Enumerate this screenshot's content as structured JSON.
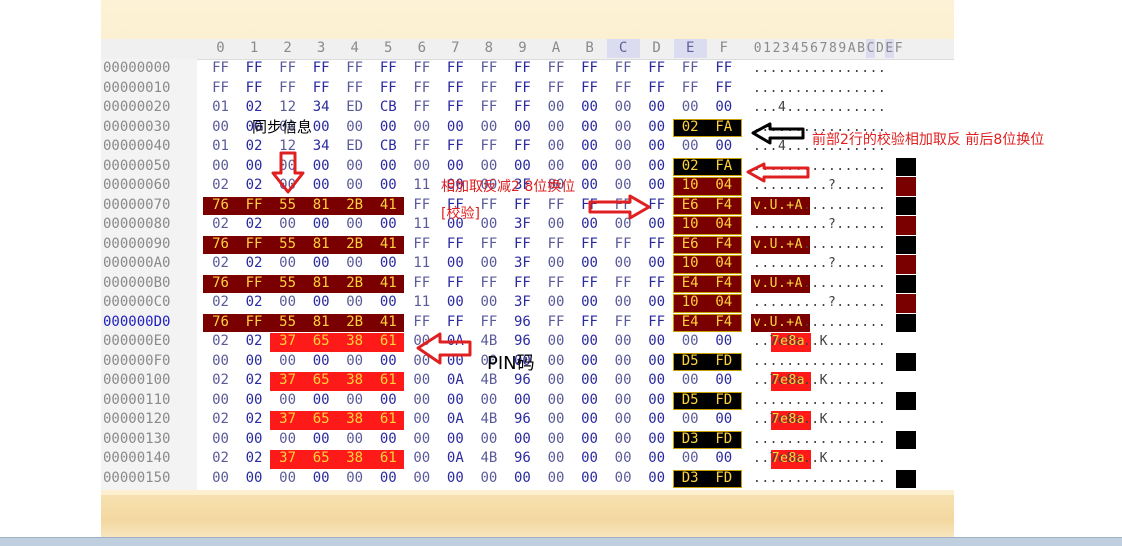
{
  "columns": [
    "0",
    "1",
    "2",
    "3",
    "4",
    "5",
    "6",
    "7",
    "8",
    "9",
    "A",
    "B",
    "C",
    "D",
    "E",
    "F"
  ],
  "ascii_header": "0123456789ABCDEF",
  "selected_columns": [
    "C",
    "E"
  ],
  "current_row_offset": "000000D0",
  "rows": [
    {
      "offset": "00000000",
      "bytes": [
        "FF",
        "FF",
        "FF",
        "FF",
        "FF",
        "FF",
        "FF",
        "FF",
        "FF",
        "FF",
        "FF",
        "FF",
        "FF",
        "FF",
        "FF",
        "FF"
      ],
      "ascii": "................"
    },
    {
      "offset": "00000010",
      "bytes": [
        "FF",
        "FF",
        "FF",
        "FF",
        "FF",
        "FF",
        "FF",
        "FF",
        "FF",
        "FF",
        "FF",
        "FF",
        "FF",
        "FF",
        "FF",
        "FF"
      ],
      "ascii": "................"
    },
    {
      "offset": "00000020",
      "bytes": [
        "01",
        "02",
        "12",
        "34",
        "ED",
        "CB",
        "FF",
        "FF",
        "FF",
        "FF",
        "00",
        "00",
        "00",
        "00",
        "00",
        "00"
      ],
      "ascii": "...4............"
    },
    {
      "offset": "00000030",
      "bytes": [
        "00",
        "00",
        "00",
        "00",
        "00",
        "00",
        "00",
        "00",
        "00",
        "00",
        "00",
        "00",
        "00",
        "00",
        "02",
        "FA"
      ],
      "ascii": "................"
    },
    {
      "offset": "00000040",
      "bytes": [
        "01",
        "02",
        "12",
        "34",
        "ED",
        "CB",
        "FF",
        "FF",
        "FF",
        "FF",
        "00",
        "00",
        "00",
        "00",
        "00",
        "00"
      ],
      "ascii": "...4............"
    },
    {
      "offset": "00000050",
      "bytes": [
        "00",
        "00",
        "00",
        "00",
        "00",
        "00",
        "00",
        "00",
        "00",
        "00",
        "00",
        "00",
        "00",
        "00",
        "02",
        "FA"
      ],
      "ascii": "................"
    },
    {
      "offset": "00000060",
      "bytes": [
        "02",
        "02",
        "00",
        "00",
        "00",
        "00",
        "11",
        "00",
        "00",
        "3F",
        "00",
        "00",
        "00",
        "00",
        "10",
        "04"
      ],
      "ascii": ".........?......"
    },
    {
      "offset": "00000070",
      "bytes": [
        "76",
        "FF",
        "55",
        "81",
        "2B",
        "41",
        "FF",
        "FF",
        "FF",
        "FF",
        "FF",
        "FF",
        "FF",
        "FF",
        "E6",
        "F4"
      ],
      "ascii": "v.U.+A.........."
    },
    {
      "offset": "00000080",
      "bytes": [
        "02",
        "02",
        "00",
        "00",
        "00",
        "00",
        "11",
        "00",
        "00",
        "3F",
        "00",
        "00",
        "00",
        "00",
        "10",
        "04"
      ],
      "ascii": ".........?......"
    },
    {
      "offset": "00000090",
      "bytes": [
        "76",
        "FF",
        "55",
        "81",
        "2B",
        "41",
        "FF",
        "FF",
        "FF",
        "FF",
        "FF",
        "FF",
        "FF",
        "FF",
        "E6",
        "F4"
      ],
      "ascii": "v.U.+A.........."
    },
    {
      "offset": "000000A0",
      "bytes": [
        "02",
        "02",
        "00",
        "00",
        "00",
        "00",
        "11",
        "00",
        "00",
        "3F",
        "00",
        "00",
        "00",
        "00",
        "10",
        "04"
      ],
      "ascii": ".........?......"
    },
    {
      "offset": "000000B0",
      "bytes": [
        "76",
        "FF",
        "55",
        "81",
        "2B",
        "41",
        "FF",
        "FF",
        "FF",
        "FF",
        "FF",
        "FF",
        "FF",
        "FF",
        "E4",
        "F4"
      ],
      "ascii": "v.U.+A.........."
    },
    {
      "offset": "000000C0",
      "bytes": [
        "02",
        "02",
        "00",
        "00",
        "00",
        "00",
        "11",
        "00",
        "00",
        "3F",
        "00",
        "00",
        "00",
        "00",
        "10",
        "04"
      ],
      "ascii": ".........?......"
    },
    {
      "offset": "000000D0",
      "bytes": [
        "76",
        "FF",
        "55",
        "81",
        "2B",
        "41",
        "FF",
        "FF",
        "FF",
        "96",
        "FF",
        "FF",
        "FF",
        "FF",
        "E4",
        "F4"
      ],
      "ascii": "v.U.+A.........."
    },
    {
      "offset": "000000E0",
      "bytes": [
        "02",
        "02",
        "37",
        "65",
        "38",
        "61",
        "00",
        "0A",
        "4B",
        "96",
        "00",
        "00",
        "00",
        "00",
        "00",
        "00"
      ],
      "ascii": "..7e8a..K......."
    },
    {
      "offset": "000000F0",
      "bytes": [
        "00",
        "00",
        "00",
        "00",
        "00",
        "00",
        "00",
        "00",
        "00",
        "00",
        "00",
        "00",
        "00",
        "00",
        "D5",
        "FD"
      ],
      "ascii": "................"
    },
    {
      "offset": "00000100",
      "bytes": [
        "02",
        "02",
        "37",
        "65",
        "38",
        "61",
        "00",
        "0A",
        "4B",
        "96",
        "00",
        "00",
        "00",
        "00",
        "00",
        "00"
      ],
      "ascii": "..7e8a..K......."
    },
    {
      "offset": "00000110",
      "bytes": [
        "00",
        "00",
        "00",
        "00",
        "00",
        "00",
        "00",
        "00",
        "00",
        "00",
        "00",
        "00",
        "00",
        "00",
        "D5",
        "FD"
      ],
      "ascii": "................"
    },
    {
      "offset": "00000120",
      "bytes": [
        "02",
        "02",
        "37",
        "65",
        "38",
        "61",
        "00",
        "0A",
        "4B",
        "96",
        "00",
        "00",
        "00",
        "00",
        "00",
        "00"
      ],
      "ascii": "..7e8a..K......."
    },
    {
      "offset": "00000130",
      "bytes": [
        "00",
        "00",
        "00",
        "00",
        "00",
        "00",
        "00",
        "00",
        "00",
        "00",
        "00",
        "00",
        "00",
        "00",
        "D3",
        "FD"
      ],
      "ascii": "................"
    },
    {
      "offset": "00000140",
      "bytes": [
        "02",
        "02",
        "37",
        "65",
        "38",
        "61",
        "00",
        "0A",
        "4B",
        "96",
        "00",
        "00",
        "00",
        "00",
        "00",
        "00"
      ],
      "ascii": "..7e8a..K......."
    },
    {
      "offset": "00000150",
      "bytes": [
        "00",
        "00",
        "00",
        "00",
        "00",
        "00",
        "00",
        "00",
        "00",
        "00",
        "00",
        "00",
        "00",
        "00",
        "D3",
        "FD"
      ],
      "ascii": "................"
    }
  ],
  "annotations": {
    "sync_info": "同步信息",
    "checksum_rule_top": "前部2行的校验相加取反 前后8位换位",
    "checksum_rule_mid": "相加取反减2 8位换位",
    "checksum_label": "[校验]",
    "pin_code": "PIN码"
  },
  "colors": {
    "checksum_highlight": "#7a0000",
    "pin_highlight": "#ff1a1a",
    "sum_highlight": "#000000",
    "annotation_red": "#e02020",
    "annotation_black": "#000000"
  }
}
